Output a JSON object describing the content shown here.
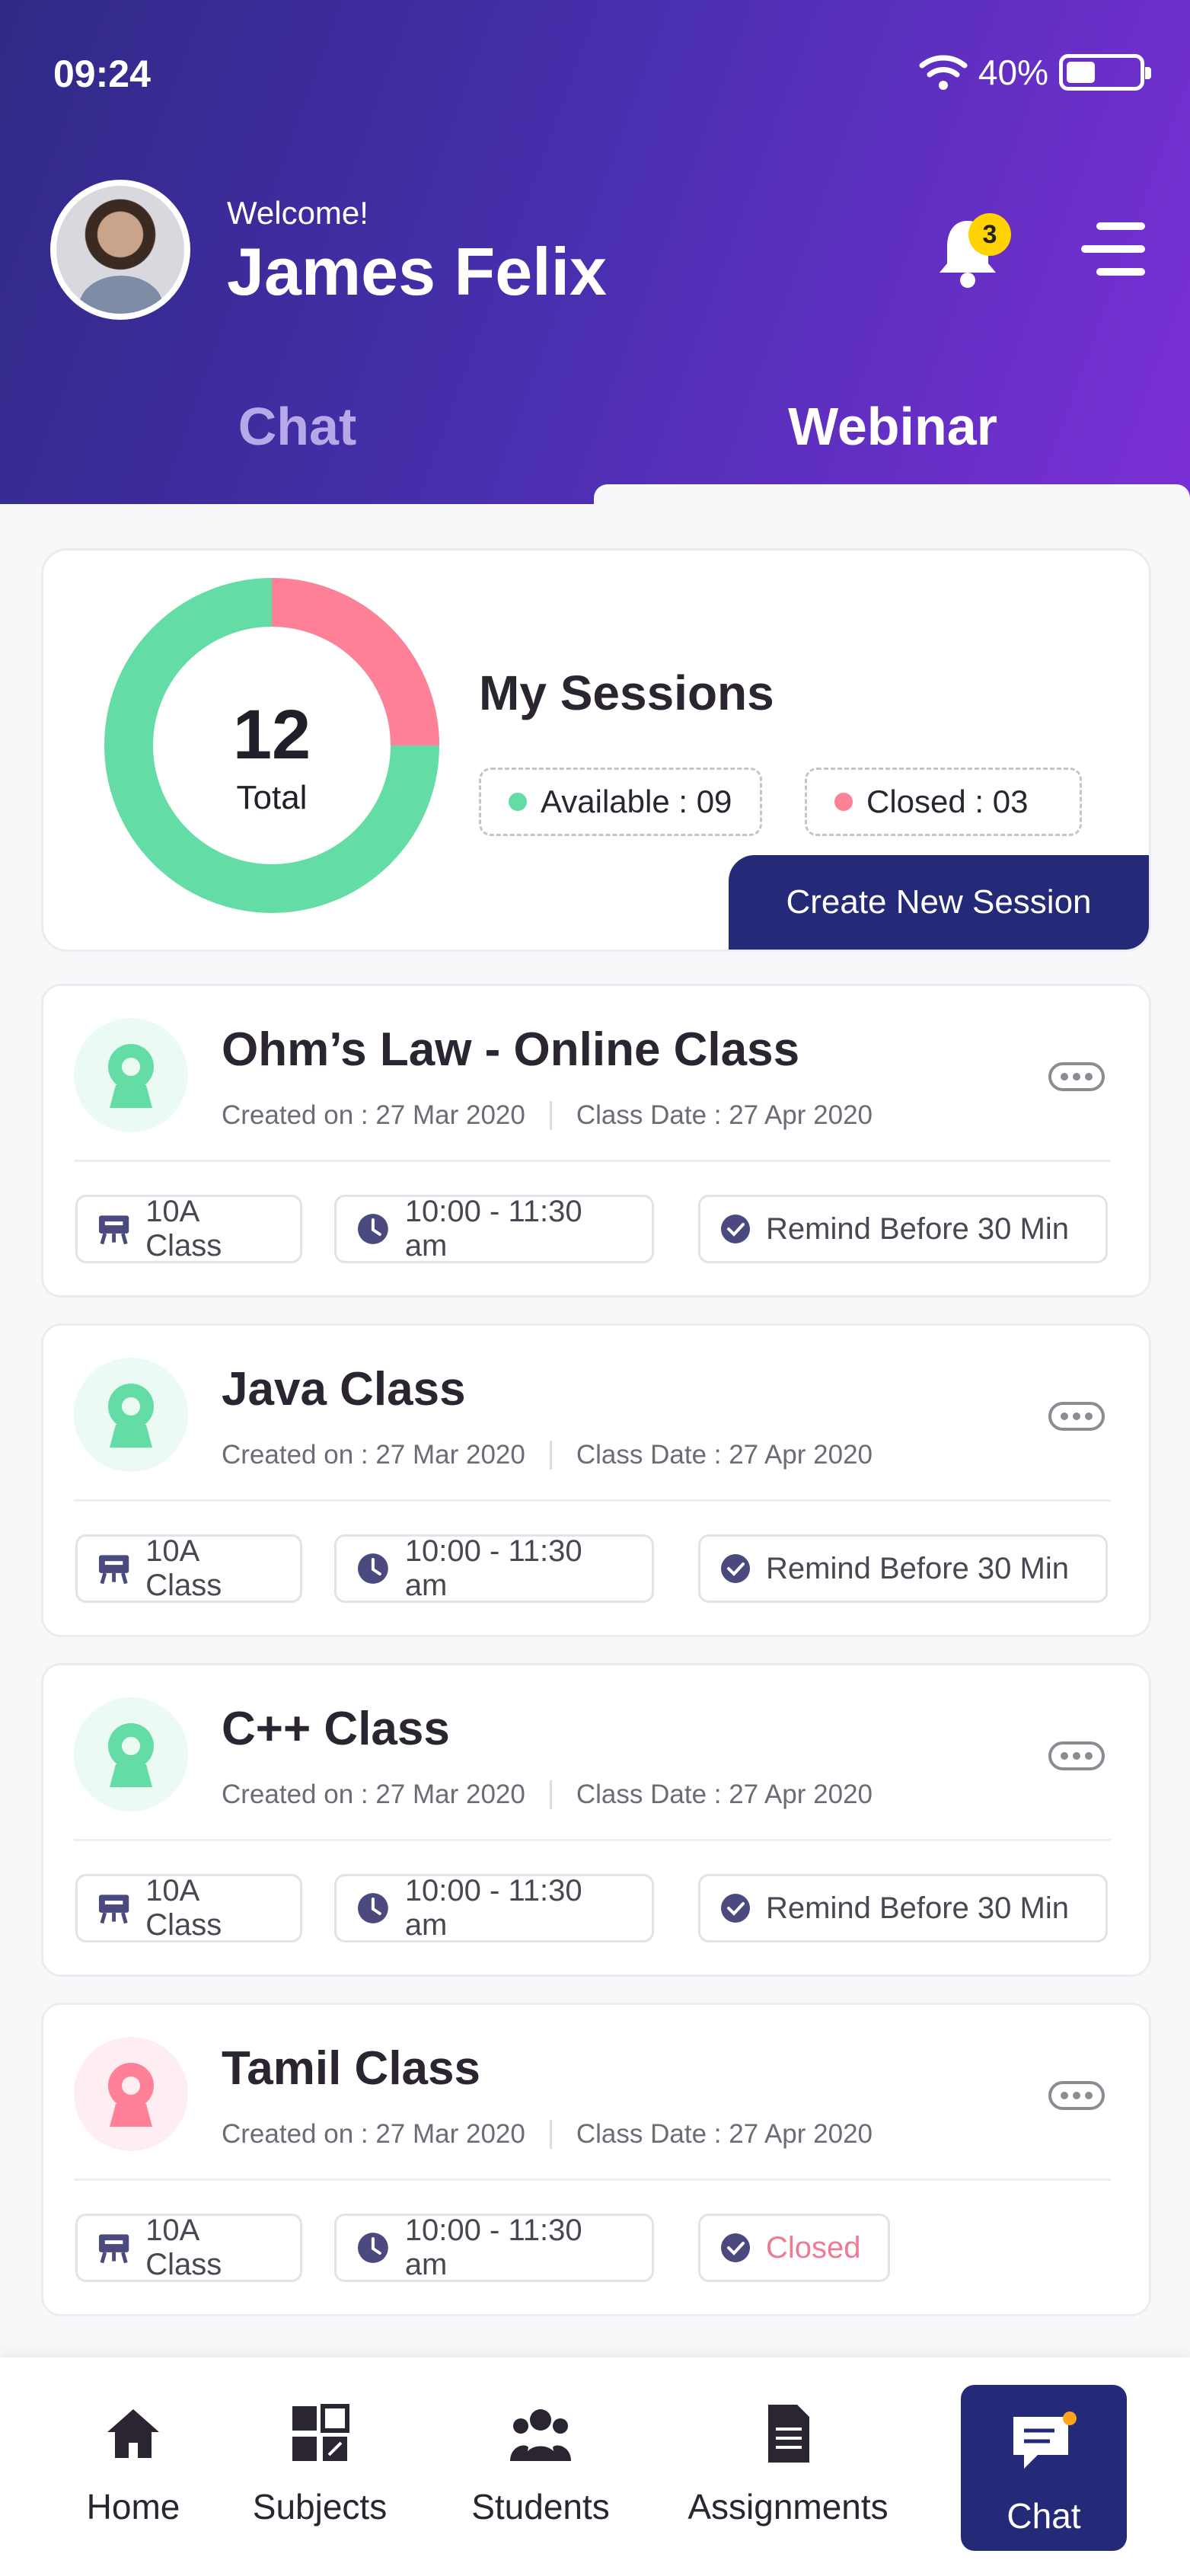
{
  "status_bar": {
    "time": "09:24",
    "battery_text": "40%",
    "battery_level": 0.4
  },
  "header": {
    "welcome": "Welcome!",
    "user_name": "James Felix",
    "notification_count": "3",
    "tabs": [
      {
        "label": "Chat",
        "active": false
      },
      {
        "label": "Webinar",
        "active": true
      }
    ]
  },
  "summary": {
    "total_value": "12",
    "total_label": "Total",
    "title": "My Sessions",
    "available_label": "Available : 09",
    "closed_label": "Closed  : 03",
    "available": 9,
    "closed": 3,
    "available_color": "#63dca6",
    "closed_color": "#ff8197",
    "create_button": "Create New Session"
  },
  "sessions": [
    {
      "title": "Ohm’s Law - Online Class",
      "created": "Created on : 27 Mar 2020",
      "class_date": "Class Date : 27 Apr 2020",
      "class": "10A Class",
      "time": "10:00 - 11:30 am",
      "reminder": "Remind Before 30 Min",
      "status": "active"
    },
    {
      "title": "Java Class",
      "created": "Created on : 27 Mar 2020",
      "class_date": "Class Date : 27 Apr 2020",
      "class": "10A Class",
      "time": "10:00 - 11:30 am",
      "reminder": "Remind Before 30 Min",
      "status": "active"
    },
    {
      "title": "C++ Class",
      "created": "Created on : 27 Mar 2020",
      "class_date": "Class Date : 27 Apr 2020",
      "class": "10A Class",
      "time": "10:00 - 11:30 am",
      "reminder": "Remind Before 30 Min",
      "status": "active"
    },
    {
      "title": "Tamil Class",
      "created": "Created on : 27 Mar 2020",
      "class_date": "Class Date : 27 Apr 2020",
      "class": "10A Class",
      "time": "10:00 - 11:30 am",
      "reminder": "Closed",
      "status": "closed"
    }
  ],
  "bottom_nav": [
    {
      "label": "Home",
      "icon": "home-icon"
    },
    {
      "label": "Subjects",
      "icon": "subjects-icon"
    },
    {
      "label": "Students",
      "icon": "students-icon"
    },
    {
      "label": "Assignments",
      "icon": "assignments-icon"
    },
    {
      "label": "Chat",
      "icon": "chat-icon",
      "active": true
    }
  ],
  "colors": {
    "header_start": "#2f2a86",
    "header_end": "#7b2fd6",
    "accent_navy": "#252a78",
    "green": "#63dca6",
    "pink": "#ff8197"
  }
}
